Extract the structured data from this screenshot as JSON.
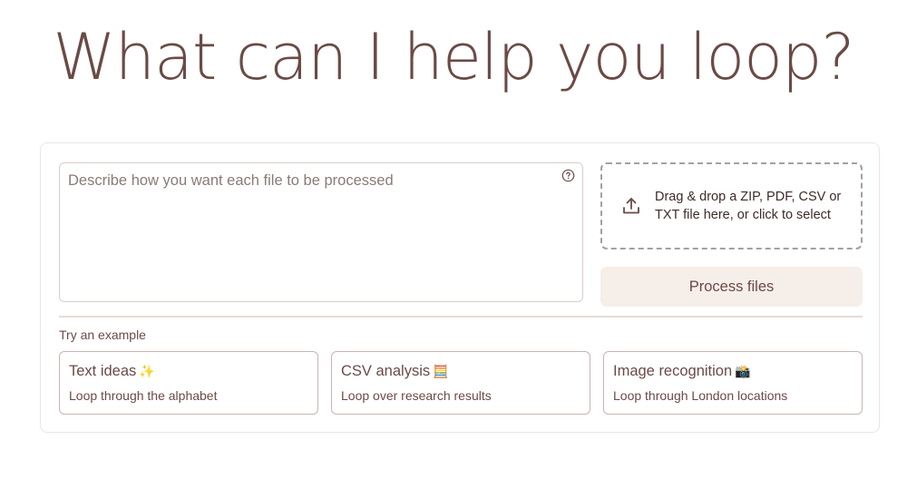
{
  "hero": {
    "title": "What can I help you loop?"
  },
  "prompt": {
    "placeholder": "Describe how you want each file to be processed",
    "value": ""
  },
  "dropzone": {
    "text": "Drag & drop a ZIP, PDF, CSV or TXT file here, or click to select"
  },
  "process_button": {
    "label": "Process files"
  },
  "examples": {
    "label": "Try an example",
    "items": [
      {
        "title": "Text ideas",
        "emoji": "✨",
        "subtitle": "Loop through the alphabet"
      },
      {
        "title": "CSV analysis",
        "emoji": "🧮",
        "subtitle": "Loop over research results"
      },
      {
        "title": "Image recognition",
        "emoji": "📸",
        "subtitle": "Loop through London locations"
      }
    ]
  },
  "icons": {
    "help": "help-circle-icon",
    "upload": "upload-icon"
  },
  "colors": {
    "brand_text": "#6b4a45",
    "button_bg": "#f6eee9",
    "border": "#d9cdc9"
  }
}
